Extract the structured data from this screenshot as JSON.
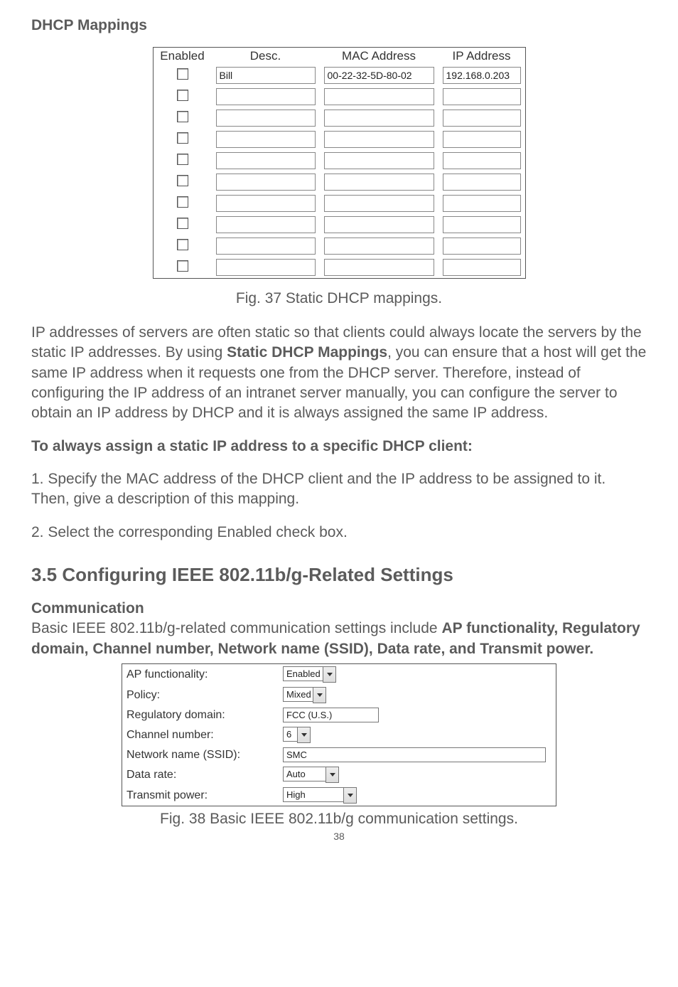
{
  "headings": {
    "dhcp_mappings": "DHCP Mappings",
    "config_ieee": "3.5 Configuring IEEE 802.11b/g-Related Settings",
    "communication": "Communication"
  },
  "dhcp_table": {
    "headers": {
      "enabled": "Enabled",
      "desc": "Desc.",
      "mac": "MAC Address",
      "ip": "IP Address"
    },
    "rows": [
      {
        "enabled": false,
        "desc": "Bill",
        "mac": "00-22-32-5D-80-02",
        "ip": "192.168.0.203"
      },
      {
        "enabled": false,
        "desc": "",
        "mac": "",
        "ip": ""
      },
      {
        "enabled": false,
        "desc": "",
        "mac": "",
        "ip": ""
      },
      {
        "enabled": false,
        "desc": "",
        "mac": "",
        "ip": ""
      },
      {
        "enabled": false,
        "desc": "",
        "mac": "",
        "ip": ""
      },
      {
        "enabled": false,
        "desc": "",
        "mac": "",
        "ip": ""
      },
      {
        "enabled": false,
        "desc": "",
        "mac": "",
        "ip": ""
      },
      {
        "enabled": false,
        "desc": "",
        "mac": "",
        "ip": ""
      },
      {
        "enabled": false,
        "desc": "",
        "mac": "",
        "ip": ""
      },
      {
        "enabled": false,
        "desc": "",
        "mac": "",
        "ip": ""
      }
    ]
  },
  "captions": {
    "fig37": "Fig. 37 Static DHCP mappings.",
    "fig38": "Fig. 38 Basic IEEE 802.11b/g communication settings."
  },
  "paragraphs": {
    "ip_static_pre": "IP addresses of servers are often static so that clients could always locate the servers by the static IP addresses. By using ",
    "ip_static_bold": "Static DHCP Mappings",
    "ip_static_post": ", you can ensure that a host will get the same IP address when it requests one from the DHCP server. Therefore, instead of configuring the IP address of an intranet server manually, you can configure the server to obtain an IP address by DHCP and it is always assigned the same IP address.",
    "assign_heading": "To always assign a static IP address to a specific DHCP client:",
    "step1": "1. Specify the MAC address of the DHCP client and the IP address to be assigned to it. Then, give a description of this mapping.",
    "step2": "2. Select the corresponding Enabled check box.",
    "comm_intro_pre": "Basic IEEE 802.11b/g-related communication settings include ",
    "comm_intro_bold": "AP functionality, Regulatory domain, Channel number, Network name (SSID), Data rate, and Transmit power."
  },
  "comm_panel": {
    "ap_functionality": {
      "label": "AP functionality:",
      "value": "Enabled"
    },
    "policy": {
      "label": "Policy:",
      "value": "Mixed"
    },
    "regulatory": {
      "label": "Regulatory domain:",
      "value": "FCC (U.S.)"
    },
    "channel": {
      "label": "Channel number:",
      "value": "6"
    },
    "ssid": {
      "label": "Network name (SSID):",
      "value": "SMC"
    },
    "data_rate": {
      "label": "Data rate:",
      "value": "Auto"
    },
    "transmit_power": {
      "label": "Transmit power:",
      "value": "High"
    }
  },
  "page_number": "38"
}
